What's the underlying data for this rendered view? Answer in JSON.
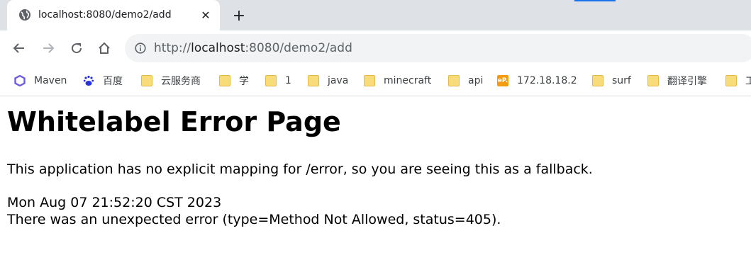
{
  "browser": {
    "tab": {
      "title": "localhost:8080/demo2/add",
      "close_symbol": "✕"
    },
    "new_tab_symbol": "+",
    "address": {
      "scheme": "http://",
      "host": "localhost",
      "rest": ":8080/demo2/add"
    },
    "icons": [
      "globe-icon",
      "back-icon",
      "forward-icon",
      "reload-icon",
      "home-icon",
      "info-icon"
    ]
  },
  "bookmarks": [
    {
      "label": "Maven",
      "icon": "maven-icon"
    },
    {
      "label": "百度",
      "icon": "baidu-icon"
    },
    {
      "label": "云服务商",
      "icon": "folder-icon"
    },
    {
      "label": "学",
      "icon": "folder-icon"
    },
    {
      "label": "1",
      "icon": "folder-icon"
    },
    {
      "label": "java",
      "icon": "folder-icon"
    },
    {
      "label": "minecraft",
      "icon": "folder-icon"
    },
    {
      "label": "api",
      "icon": "folder-icon"
    },
    {
      "label": "172.18.18.2",
      "icon": "ep-icon",
      "icon_text": "eP."
    },
    {
      "label": "surf",
      "icon": "folder-icon"
    },
    {
      "label": "翻译引擎",
      "icon": "folder-icon"
    },
    {
      "label": "工",
      "icon": "folder-icon"
    }
  ],
  "page": {
    "heading": "Whitelabel Error Page",
    "message": "This application has no explicit mapping for /error, so you are seeing this as a fallback.",
    "timestamp": "Mon Aug 07 21:52:20 CST 2023",
    "error": "There was an unexpected error (type=Method Not Allowed, status=405)."
  },
  "colors": {
    "tabstrip": "#dee1e6",
    "omnibox": "#f1f3f4",
    "folder": "#f9dc7a",
    "maven": "#6c5ce7",
    "baidu": "#2932e1",
    "ep": "#f39c12"
  }
}
